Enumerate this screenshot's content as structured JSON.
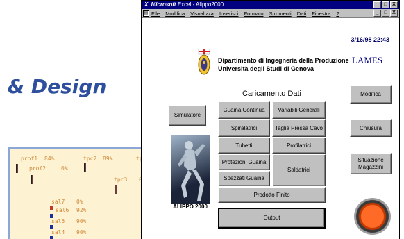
{
  "slide": {
    "title": "e & Design"
  },
  "monitor": {
    "labels": {
      "prof1": "prof1",
      "prof1_val": "84%",
      "tpc2": "tpc2",
      "tpc2_val": "89%",
      "tp": "tp",
      "prof2": "prof2",
      "prof2_val": "0%",
      "tpc3": "tpc3",
      "tpc3_val": "0",
      "sal7": "sal7",
      "sal7_val": "0%",
      "sal6": "sal6",
      "sal6_val": "92%",
      "sal5": "sal5",
      "sal5_val": "90%",
      "sal4": "sal4",
      "sal4_val": "90%"
    }
  },
  "window": {
    "title_app": "Microsoft",
    "title_rest": "Excel - Alippo2000",
    "controls": [
      "_",
      "□",
      "X"
    ],
    "menu": [
      "File",
      "Modifica",
      "Visualizza",
      "Inserisci",
      "Formato",
      "Strumenti",
      "Dati",
      "Finestra",
      "?"
    ],
    "menu_controls": [
      "_",
      "□",
      "X"
    ]
  },
  "header": {
    "datetime": "3/16/98 22:43",
    "dept_line1": "Dipartimento di Ingegneria della Produzione",
    "dept_line2": "Università degli Studi di Genova",
    "lames": "LAMES"
  },
  "panel": {
    "title": "Caricamento Dati",
    "buttons": {
      "guaina_continua": "Guaina Continua",
      "variabili_generali": "Variabili Generali",
      "spiralatrici": "Spiralatrici",
      "taglia_pressa_cavo": "Taglia Pressa Cavo",
      "tubetti": "Tubetti",
      "profilatrici": "Profilatrici",
      "protezioni_guaina": "Protezioni Guaina",
      "saldatrici": "Saldatrici",
      "spezzati_guaina": "Spezzati Guaina",
      "prodotto_finito": "Prodotto Finito",
      "output": "Output"
    }
  },
  "left": {
    "simulatore": "Simulatore",
    "photo_caption": "ALIPPO 2000"
  },
  "right": {
    "modifica": "Modifica",
    "chiusura": "Chiusura",
    "situazione_line1": "Situazione",
    "situazione_line2": "Magazzini"
  }
}
